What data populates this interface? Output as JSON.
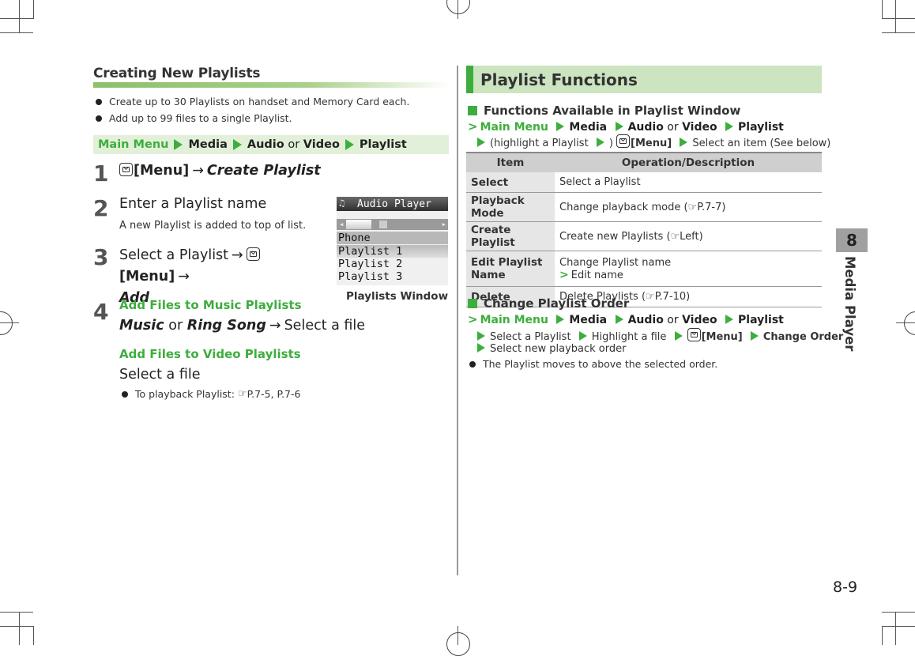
{
  "page": {
    "number": "8-9",
    "chapter_number": "8",
    "chapter_title": "Media Player"
  },
  "left": {
    "section_title": "Creating New Playlists",
    "bullets": [
      "Create up to 30 Playlists on handset and Memory Card each.",
      "Add up to 99 files to a single Playlist."
    ],
    "path": {
      "main_menu": "Main Menu",
      "media": "Media",
      "audio": "Audio",
      "or": "or",
      "video": "Video",
      "playlist": "Playlist"
    },
    "steps": [
      {
        "num": "1",
        "key": "[Menu]",
        "arrow": "→",
        "target": "Create Playlist"
      },
      {
        "num": "2",
        "text": "Enter a Playlist name",
        "note": "A new Playlist is added to top of list."
      },
      {
        "num": "3",
        "text": "Select a Playlist",
        "arrow": "→",
        "key": "[Menu]",
        "target": "Add"
      },
      {
        "num": "4",
        "music_heading": "Add Files to Music Playlists",
        "music_a": "Music",
        "music_or": "or",
        "music_b": "Ring Song",
        "music_arrow": "→",
        "music_tail": "Select a file",
        "video_heading": "Add Files to Video Playlists",
        "video_text": "Select a file",
        "bullet": "To playback Playlist:",
        "bullet_ref": "P.7-5, P.7-6"
      }
    ],
    "figure": {
      "title": "Audio Player",
      "header_row": "Phone",
      "rows": [
        "Playlist 1",
        "Playlist 2",
        "Playlist 3"
      ],
      "caption": "Playlists Window"
    }
  },
  "right": {
    "section_title": "Playlist Functions",
    "sub1": {
      "heading": "Functions Available in Playlist Window",
      "path1": {
        "main_menu": "Main Menu",
        "media": "Media",
        "audio": "Audio",
        "or": "or",
        "video": "Video",
        "playlist": "Playlist"
      },
      "path2": {
        "highlight_open": "(highlight a Playlist",
        "highlight_close": ")",
        "key": "[Menu]",
        "select": "Select an item (See below)"
      }
    },
    "table": {
      "headers": [
        "Item",
        "Operation/Description"
      ],
      "rows": [
        {
          "item": "Select",
          "desc": "Select a Playlist"
        },
        {
          "item": "Playback Mode",
          "desc": "Change playback mode (",
          "ref": "P.7-7",
          "close": ")"
        },
        {
          "item": "Create Playlist",
          "desc": "Create new Playlists (",
          "ref": "Left",
          "close": ")"
        },
        {
          "item": "Edit Playlist Name",
          "desc": "Change Playlist name",
          "sub": "Edit name"
        },
        {
          "item": "Delete",
          "desc": "Delete Playlists (",
          "ref": "P.7-10",
          "close": ")"
        }
      ]
    },
    "sub2": {
      "heading": "Change Playlist Order",
      "path1": {
        "main_menu": "Main Menu",
        "media": "Media",
        "audio": "Audio",
        "or": "or",
        "video": "Video",
        "playlist": "Playlist"
      },
      "path2": {
        "select": "Select a Playlist",
        "highlight": "Highlight a file",
        "key": "[Menu]",
        "change": "Change Order"
      },
      "path3": "Select new playback order",
      "bullet": "The Playlist moves to above the selected order."
    }
  }
}
